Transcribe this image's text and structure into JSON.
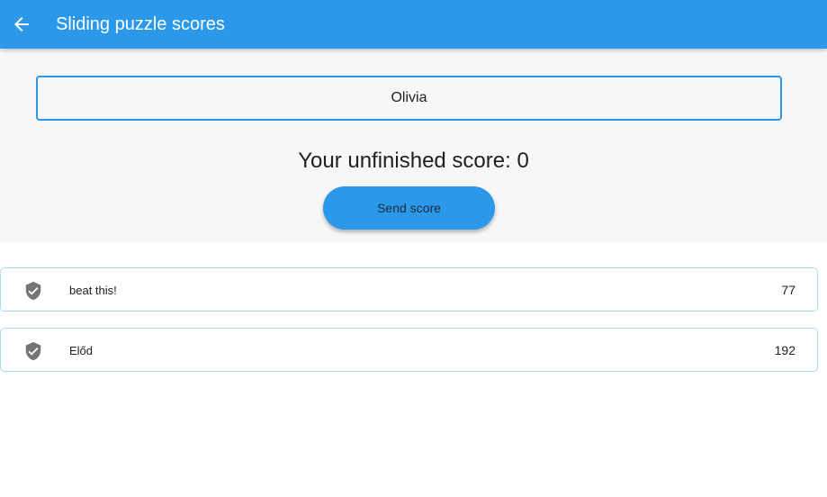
{
  "appbar": {
    "title": "Sliding puzzle scores",
    "back_icon": "arrow-back-icon",
    "color": "#2b98ea"
  },
  "form": {
    "name_value": "Olivia",
    "score_text": "Your unfinished score: 0",
    "send_label": "Send score"
  },
  "scores": [
    {
      "name": "beat this!",
      "score": "77",
      "icon": "verified-shield-icon"
    },
    {
      "name": "Előd",
      "score": "192",
      "icon": "verified-shield-icon"
    }
  ],
  "colors": {
    "accent": "#2b98ea",
    "row_border": "#a8dbee",
    "icon": "#757575"
  }
}
